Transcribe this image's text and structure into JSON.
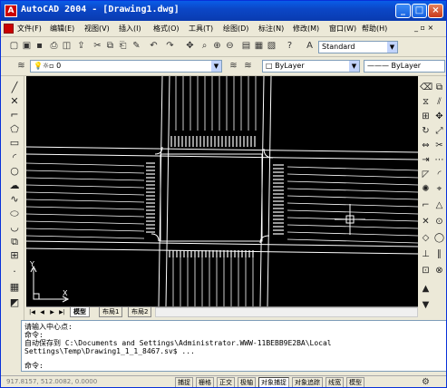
{
  "window": {
    "title": "AutoCAD 2004 - [Drawing1.dwg]",
    "minimize": "_",
    "maximize": "□",
    "close": "×"
  },
  "menu": {
    "items": [
      "文件(F)",
      "编辑(E)",
      "视图(V)",
      "插入(I)",
      "格式(O)",
      "工具(T)",
      "绘图(D)",
      "标注(N)",
      "修改(M)",
      "窗口(W)",
      "帮助(H)"
    ],
    "doc_controls": "_ ▫ ×"
  },
  "toolbar": {
    "text_style": "Standard"
  },
  "layers": {
    "current_layer": "0",
    "color": "ByLayer",
    "linetype": "ByLayer"
  },
  "layout_tabs": [
    "模型",
    "布局1",
    "布局2"
  ],
  "ucs": {
    "x_label": "X",
    "y_label": "Y"
  },
  "command_lines": [
    "请输入中心点:",
    "命令:",
    "自动保存到 C:\\Documents and Settings\\Administrator.WWW-11BEBB9E2BA\\Local",
    "Settings\\Temp\\Drawing1_1_1_8467.sv$ ...",
    "命令:"
  ],
  "status": {
    "coords": "917.8157, 512.0082, 0.0000",
    "buttons": [
      "捕捉",
      "栅格",
      "正交",
      "极轴",
      "对象捕捉",
      "对象追踪",
      "线宽",
      "模型"
    ],
    "active": [
      "对象捕捉"
    ]
  },
  "colors": {
    "title_bar": "#0b47c7",
    "canvas": "#000000",
    "drawing_lines": "#ffffff"
  }
}
